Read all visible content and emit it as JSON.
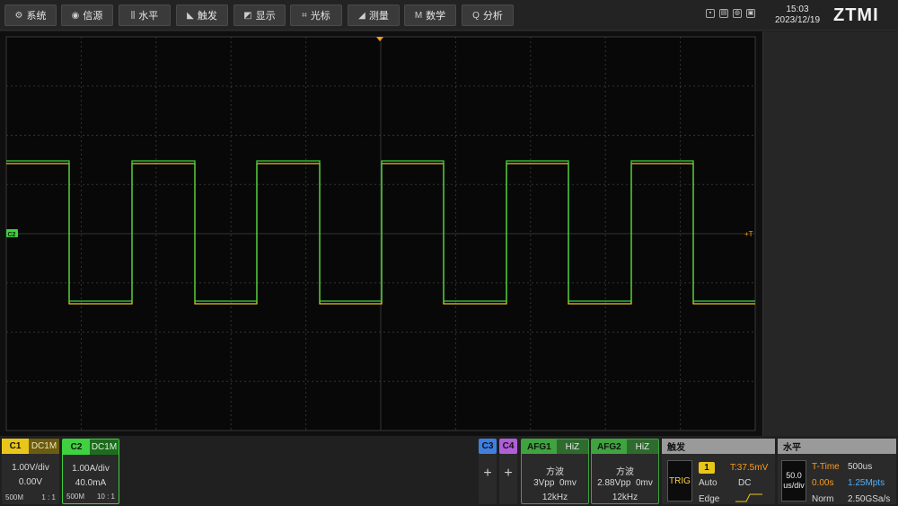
{
  "menu": [
    {
      "icon": "⚙",
      "label": "系统",
      "icon_name": "gear-icon"
    },
    {
      "icon": "◉",
      "label": "信源",
      "icon_name": "signal-source-icon"
    },
    {
      "icon": "⫼",
      "label": "水平",
      "icon_name": "horizontal-icon"
    },
    {
      "icon": "◣",
      "label": "触发",
      "icon_name": "trigger-icon"
    },
    {
      "icon": "◩",
      "label": "显示",
      "icon_name": "display-icon"
    },
    {
      "icon": "⌗",
      "label": "光标",
      "icon_name": "cursor-icon"
    },
    {
      "icon": "◢",
      "label": "测量",
      "icon_name": "measure-icon"
    },
    {
      "icon": "M",
      "label": "数学",
      "icon_name": "math-icon"
    },
    {
      "icon": "Q",
      "label": "分析",
      "icon_name": "analysis-icon"
    }
  ],
  "clock": {
    "time": "15:03",
    "date": "2023/12/19"
  },
  "logo": "ZTMI",
  "scope": {
    "trigger_marker": "+T",
    "channel_marker": "C2",
    "colors": {
      "c1": "#e8c71a",
      "c2": "#3fd13f",
      "grid": "#333333",
      "trigger": "#ff9a1a"
    }
  },
  "channels": [
    {
      "tag": "C1",
      "coupling": "DC1M",
      "scale": "1.00V/div",
      "offset": "0.00V",
      "bw": "500M",
      "probe": "1 : 1",
      "color": "#e8c71a"
    },
    {
      "tag": "C2",
      "coupling": "DC1M",
      "scale": "1.00A/div",
      "offset": "40.0mA",
      "bw": "500M",
      "probe": "10 : 1",
      "color": "#3fd13f"
    }
  ],
  "add_channels": [
    {
      "tag": "C3",
      "color": "#3f7fe0",
      "plus": "+"
    },
    {
      "tag": "C4",
      "color": "#b05ed9",
      "plus": "+"
    }
  ],
  "afg": [
    {
      "name": "AFG1",
      "impedance": "HiZ",
      "wave": "方波",
      "amp": "3Vpp",
      "offset": "0mv",
      "freq": "12kHz"
    },
    {
      "name": "AFG2",
      "impedance": "HiZ",
      "wave": "方波",
      "amp": "2.88Vpp",
      "offset": "0mv",
      "freq": "12kHz"
    }
  ],
  "trigger": {
    "title": "触发",
    "box": "TRIG",
    "source": "1",
    "level": "T:37.5mV",
    "mode": "Auto",
    "coupling": "DC",
    "type": "Edge"
  },
  "horizontal": {
    "title": "水平",
    "scale_value": "50.0",
    "scale_unit": "us/div",
    "t_time_label": "T-Time",
    "t_time_value": "500us",
    "delay": "0.00s",
    "points": "1.25Mpts",
    "acq_mode": "Norm",
    "sample_rate": "2.50GSa/s"
  }
}
